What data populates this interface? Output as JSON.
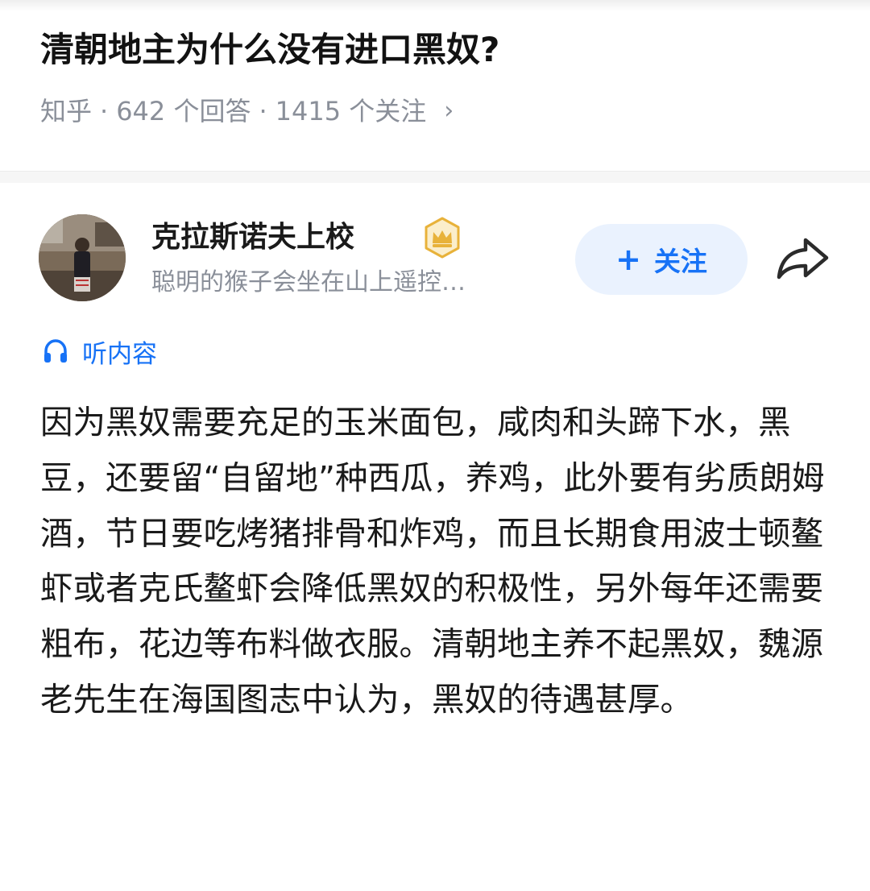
{
  "question": {
    "title": "清朝地主为什么没有进口黑奴?",
    "source": "知乎",
    "answers": "642 个回答",
    "followers": "1415 个关注",
    "separator": "·",
    "chevron": "›"
  },
  "author": {
    "name": "克拉斯诺夫上校",
    "bio": "聪明的猴子会坐在山上遥控…",
    "badge_icon": "crown-badge-icon",
    "follow_plus": "+",
    "follow_label": "关注",
    "share_icon": "share-arrow-icon"
  },
  "listen": {
    "icon": "headphones-icon",
    "label": "听内容"
  },
  "answer": {
    "text": "因为黑奴需要充足的玉米面包，咸肉和头蹄下水，黑豆，还要留“自留地”种西瓜，养鸡，此外要有劣质朗姆酒，节日要吃烤猪排骨和炸鸡，而且长期食用波士顿鳌虾或者克氏鳌虾会降低黑奴的积极性，另外每年还需要粗布，花边等布料做衣服。清朝地主养不起黑奴，魏源老先生在海国图志中认为，黑奴的待遇甚厚。"
  },
  "colors": {
    "accent": "#1772f6",
    "accent_bg": "#eaf2fe",
    "meta_gray": "#8a8f99",
    "badge_gold": "#e8b23a"
  }
}
